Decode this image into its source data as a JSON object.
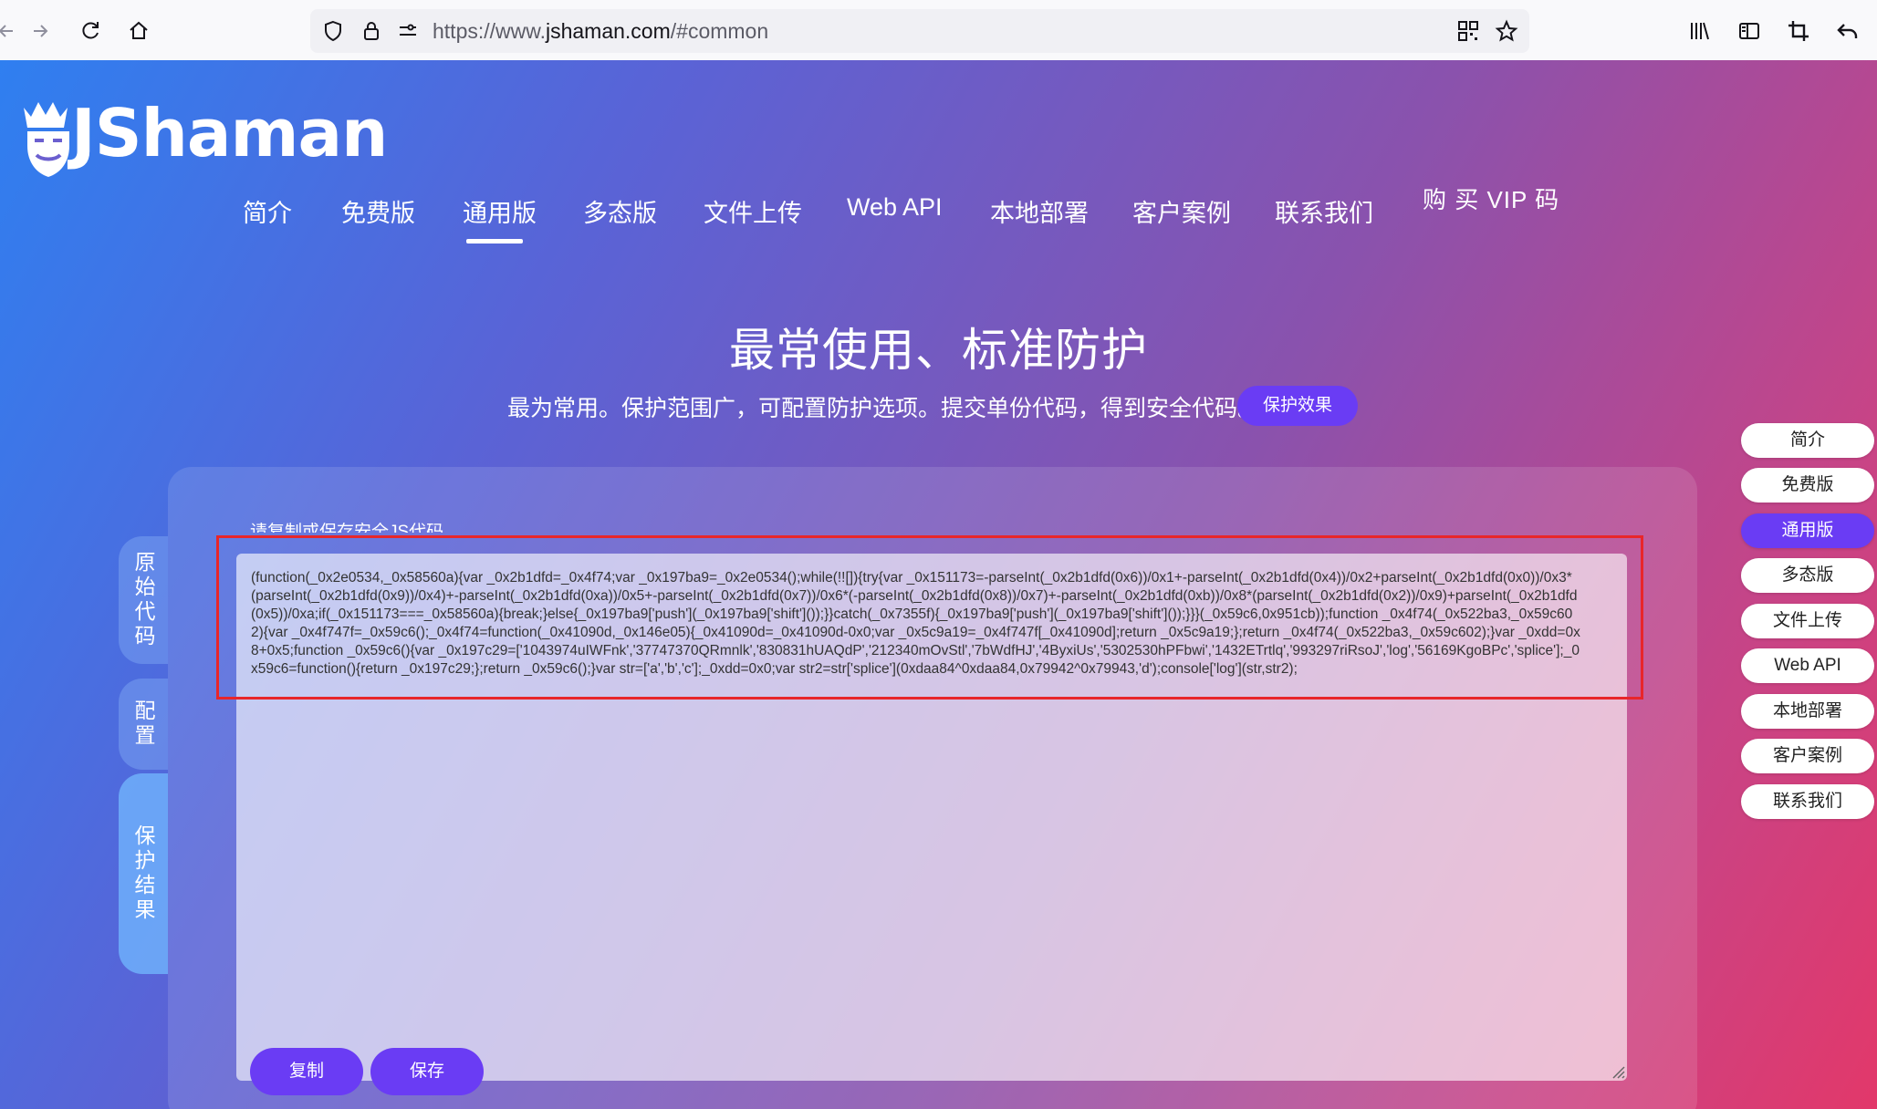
{
  "browser": {
    "url_prefix": "https://www.",
    "url_host": "jshaman.com",
    "url_suffix": "/#common"
  },
  "site": {
    "logo_text": "JShaman",
    "nav": [
      "简介",
      "免费版",
      "通用版",
      "多态版",
      "文件上传",
      "Web API",
      "本地部署",
      "客户案例",
      "联系我们"
    ],
    "buy_vip": "购 买 VIP 码",
    "hero_title": "最常使用、标准防护",
    "hero_subtitle": "最为常用。保护范围广，可配置防护选项。提交单份代码，得到安全代码。",
    "effect_button": "保护效果",
    "panel_label": "请复制或保存安全JS代码",
    "code": "(function(_0x2e0534,_0x58560a){var _0x2b1dfd=_0x4f74;var _0x197ba9=_0x2e0534();while(!![]){try{var _0x151173=-parseInt(_0x2b1dfd(0x6))/0x1+-parseInt(_0x2b1dfd(0x4))/0x2+parseInt(_0x2b1dfd(0x0))/0x3*(parseInt(_0x2b1dfd(0x9))/0x4)+-parseInt(_0x2b1dfd(0xa))/0x5+-parseInt(_0x2b1dfd(0x7))/0x6*(-parseInt(_0x2b1dfd(0x8))/0x7)+-parseInt(_0x2b1dfd(0xb))/0x8*(parseInt(_0x2b1dfd(0x2))/0x9)+parseInt(_0x2b1dfd(0x5))/0xa;if(_0x151173===_0x58560a){break;}else{_0x197ba9['push'](_0x197ba9['shift']());}}catch(_0x7355f){_0x197ba9['push'](_0x197ba9['shift']());}}}(_0x59c6,0x951cb));function _0x4f74(_0x522ba3,_0x59c602){var _0x4f747f=_0x59c6();_0x4f74=function(_0x41090d,_0x146e05){_0x41090d=_0x41090d-0x0;var _0x5c9a19=_0x4f747f[_0x41090d];return _0x5c9a19;};return _0x4f74(_0x522ba3,_0x59c602);}var _0xdd=0x8+0x5;function _0x59c6(){var _0x197c29=['1043974uIWFnk','37747370QRmnlk','830831hUAQdP','212340mOvStl','7bWdfHJ','4ByxiUs','5302530hPFbwi','1432ETrtlq','993297riRsoJ','log','56169KgoBPc','splice'];_0x59c6=function(){return _0x197c29;};return _0x59c6();}var str=['a','b','c'];_0xdd=0x0;var str2=str['splice'](0xdaa84^0xdaa84,0x79942^0x79943,'d');console['log'](str,str2);",
    "copy_button": "复制",
    "save_button": "保存",
    "left_tabs": [
      "原始代码",
      "配置",
      "保护结果"
    ],
    "side_nav": [
      "简介",
      "免费版",
      "通用版",
      "多态版",
      "文件上传",
      "Web API",
      "本地部署",
      "客户案例",
      "联系我们"
    ],
    "active_item": "通用版"
  },
  "colors": {
    "accent": "#6a3cf4",
    "highlight": "#e8262a"
  }
}
